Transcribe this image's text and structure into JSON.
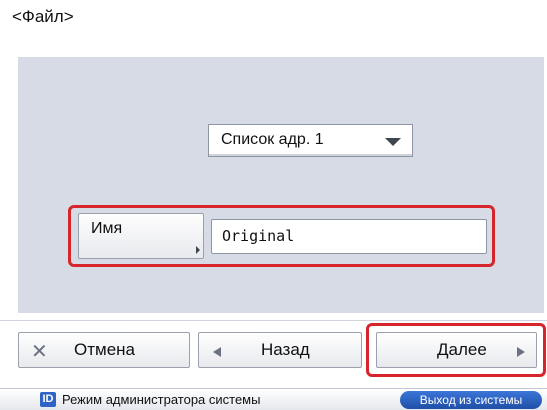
{
  "header": {
    "title": "<Файл>"
  },
  "address_book": {
    "selected": "Список адр. 1",
    "caret_icon": "dropdown-arrow-icon"
  },
  "name_field": {
    "key_label": "Имя",
    "value": "Original"
  },
  "footer_buttons": {
    "cancel": {
      "label": "Отмена",
      "icon": "close-x-icon"
    },
    "back": {
      "label": "Назад",
      "icon": "triangle-left-icon"
    },
    "next": {
      "label": "Далее",
      "icon": "triangle-right-icon"
    }
  },
  "status_bar": {
    "badge": "ID",
    "mode_text": "Режим администратора системы",
    "logout_label": "Выход из системы"
  },
  "colors": {
    "highlight": "#d6262c",
    "panel": "#d6dbe5",
    "logout_button": "#2a5fc0",
    "id_badge": "#2f63c6"
  }
}
